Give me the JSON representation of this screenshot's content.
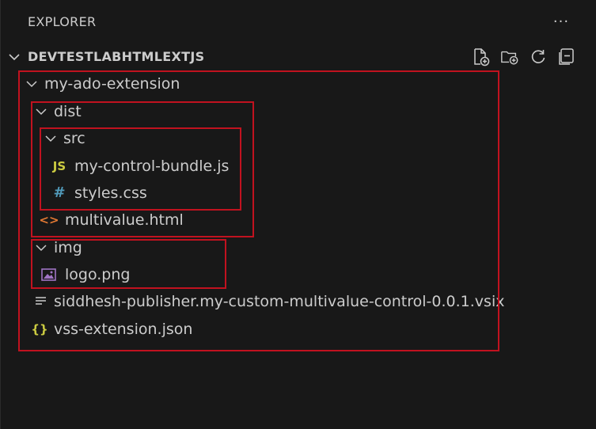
{
  "header": {
    "title": "EXPLORER",
    "more_actions": "···"
  },
  "section": {
    "title": "DEVTESTLABHTMLEXTJS",
    "toolbar": [
      "new-file-icon",
      "new-folder-icon",
      "refresh-icon",
      "collapse-all-icon"
    ]
  },
  "tree": {
    "root_folder": "my-ado-extension",
    "dist_folder": "dist",
    "src_folder": "src",
    "bundle_file": "my-control-bundle.js",
    "bundle_icon": "JS",
    "styles_file": "styles.css",
    "styles_icon": "#",
    "html_file": "multivalue.html",
    "html_icon": "<>",
    "img_folder": "img",
    "logo_file": "logo.png",
    "vsix_file": "siddhesh-publisher.my-custom-multivalue-control-0.0.1.vsix",
    "json_file": "vss-extension.json",
    "json_icon": "{}"
  },
  "colors": {
    "background": "#181818",
    "text": "#cccccc",
    "highlight_box": "#c1121f",
    "js_icon": "#cbcb41",
    "css_icon": "#519aba",
    "html_icon": "#e37933",
    "image_icon": "#a074c4",
    "json_icon": "#cbcb41"
  }
}
